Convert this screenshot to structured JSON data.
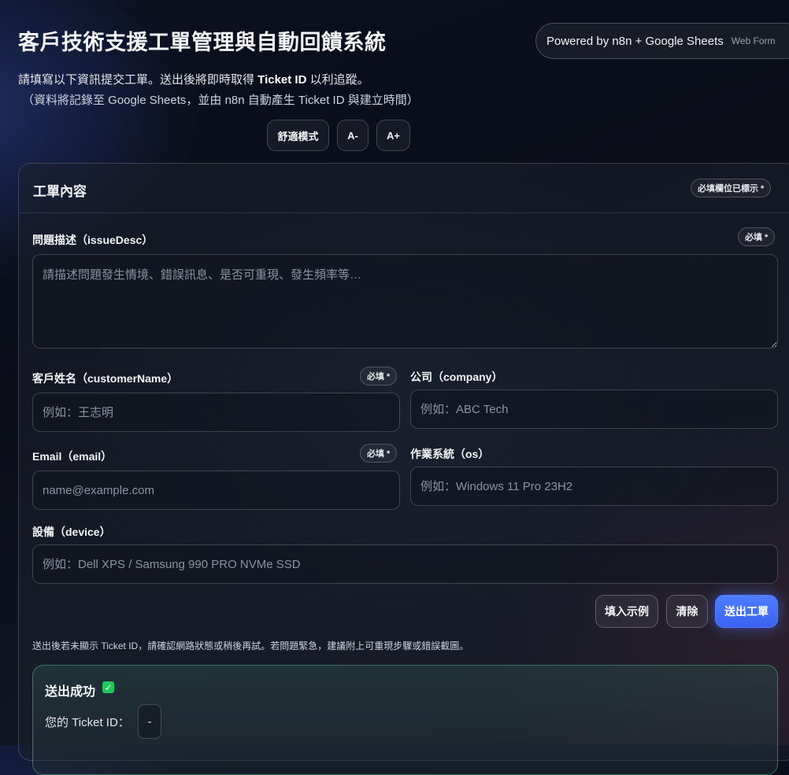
{
  "header": {
    "title": "客戶技術支援工單管理與自動回饋系統",
    "powered_by": "Powered by n8n + Google Sheets",
    "form_tag": "Web Form",
    "intro_prefix": "請填寫以下資訊提交工單。送出後將即時取得 ",
    "intro_bold": "Ticket ID",
    "intro_suffix": " 以利追蹤。",
    "intro_note": "（資料將記錄至 Google Sheets，並由 n8n 自動產生 Ticket ID 與建立時間）"
  },
  "toolbar": {
    "comfort_mode": "舒適模式",
    "font_smaller": "A-",
    "font_larger": "A+"
  },
  "card": {
    "title": "工單內容",
    "required_hint": "必填欄位已標示 *"
  },
  "fields": {
    "issue": {
      "label": "問題描述（issueDesc）",
      "badge": "必填 *",
      "placeholder": "請描述問題發生情境、錯誤訊息、是否可重現、發生頻率等…",
      "value": ""
    },
    "customer": {
      "label": "客戶姓名（customerName）",
      "badge": "必填 *",
      "placeholder": "例如：王志明",
      "value": ""
    },
    "company": {
      "label": "公司（company）",
      "placeholder": "例如：ABC Tech",
      "value": ""
    },
    "email": {
      "label": "Email（email）",
      "badge": "必填 *",
      "placeholder": "name@example.com",
      "value": ""
    },
    "os": {
      "label": "作業系統（os）",
      "placeholder": "例如：Windows 11 Pro 23H2",
      "value": ""
    },
    "device": {
      "label": "設備（device）",
      "placeholder": "例如：Dell XPS / Samsung 990 PRO NVMe SSD",
      "value": ""
    }
  },
  "actions": {
    "fill_example": "填入示例",
    "clear": "清除",
    "submit": "送出工單"
  },
  "note": "送出後若未顯示 Ticket ID，請確認網路狀態或稍後再試。若問題緊急，建議附上可重現步驟或錯誤截圖。",
  "result": {
    "title": "送出成功",
    "check_glyph": "✓",
    "ticket_label": "您的 Ticket ID：",
    "ticket_value": "-"
  },
  "colors": {
    "accent": "#4f7cff",
    "success": "#22c55e"
  },
  "icons": {
    "success": "check-icon"
  }
}
